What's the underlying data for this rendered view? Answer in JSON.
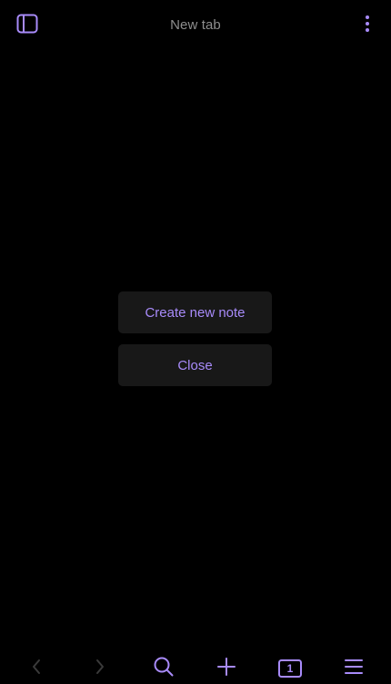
{
  "header": {
    "title": "New tab",
    "sidebar_icon": "sidebar-panel-icon",
    "more_icon": "more-vertical-icon"
  },
  "dialog": {
    "create_label": "Create new note",
    "close_label": "Close"
  },
  "bottom_nav": {
    "back_icon": "chevron-left-icon",
    "forward_icon": "chevron-right-icon",
    "search_icon": "search-icon",
    "new_icon": "plus-icon",
    "tabs_count": "1",
    "menu_icon": "hamburger-icon"
  },
  "colors": {
    "background": "#000000",
    "accent": "#a88bfa",
    "disabled": "#3a3a3a",
    "button_bg": "#181818",
    "title_text": "#8e8e8e"
  }
}
